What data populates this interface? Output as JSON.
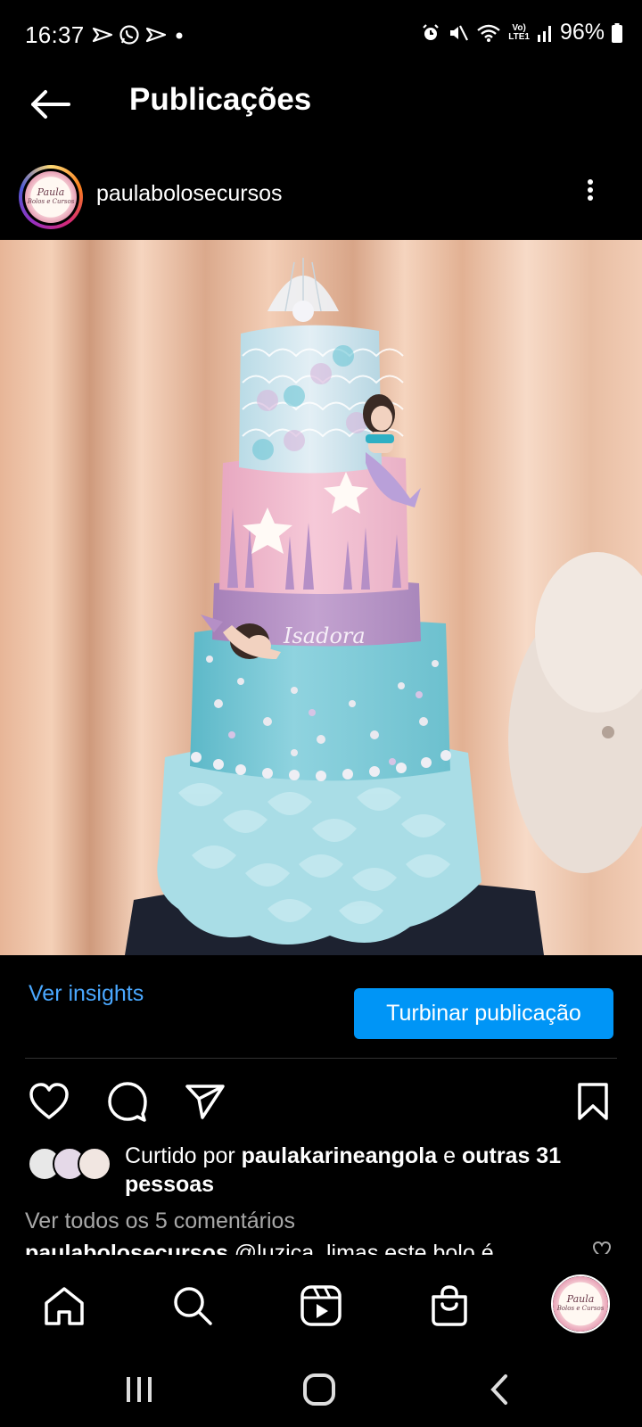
{
  "status_bar": {
    "time": "16:37",
    "battery": "96%",
    "network_label_top": "Vo)",
    "network_label_bottom": "LTE1",
    "icons": [
      "send-icon",
      "whatsapp-icon",
      "send-icon",
      "dot-icon",
      "alarm-icon",
      "mute-icon",
      "wifi-icon",
      "signal-icon",
      "battery-icon"
    ]
  },
  "header": {
    "title": "Publicações",
    "back_icon": "arrow-left-icon"
  },
  "post": {
    "username": "paulabolosecursos",
    "avatar_text_main": "Paula",
    "avatar_text_sub": "Bolos e Cursos",
    "cake_name": "Isadora",
    "insights_label": "Ver insights",
    "boost_label": "Turbinar publicação",
    "likes_prefix": "Curtido por ",
    "likes_user": "paulakarineangola",
    "likes_middle": " e ",
    "likes_others": "outras 31 pessoas",
    "comments_link": "Ver todos os 5 comentários",
    "caption_user": "paulabolosecursos",
    "caption_text": " @luzica_limas este bolo é"
  },
  "colors": {
    "accent_blue": "#0095f6",
    "link_blue": "#4aa8ff",
    "muted_gray": "#a8a8a8"
  },
  "bottom_nav": [
    "home-icon",
    "search-icon",
    "reels-icon",
    "shop-icon",
    "profile-avatar"
  ],
  "system_nav": [
    "recent-apps-icon",
    "home-circle-icon",
    "back-chevron-icon"
  ]
}
